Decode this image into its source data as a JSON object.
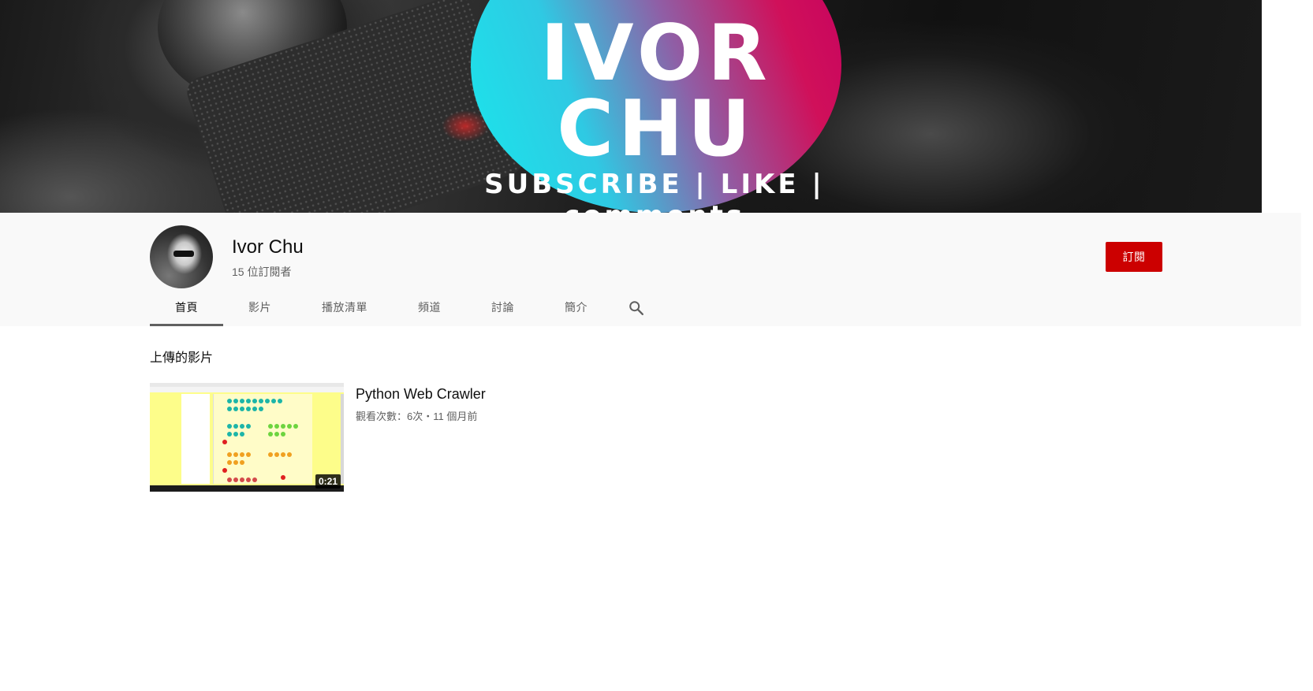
{
  "banner": {
    "logo_line1": "IVOR",
    "logo_line2": "CHU",
    "tagline": "SUBSCRIBE | LIKE | comments"
  },
  "channel": {
    "name": "Ivor Chu",
    "subscribers": "15 位訂閱者",
    "subscribe_label": "訂閱"
  },
  "tabs": [
    {
      "label": "首頁",
      "active": true
    },
    {
      "label": "影片",
      "active": false
    },
    {
      "label": "播放清單",
      "active": false
    },
    {
      "label": "頻道",
      "active": false
    },
    {
      "label": "討論",
      "active": false
    },
    {
      "label": "簡介",
      "active": false
    }
  ],
  "search_icon": "search-icon",
  "uploads": {
    "section_title": "上傳的影片",
    "videos": [
      {
        "title": "Python Web Crawler",
        "meta": "觀看次數：6次・11 個月前",
        "duration": "0:21"
      }
    ]
  },
  "colors": {
    "subscribe_red": "#cc0000",
    "header_bg": "#f9f9f9",
    "secondary_text": "#606060"
  }
}
